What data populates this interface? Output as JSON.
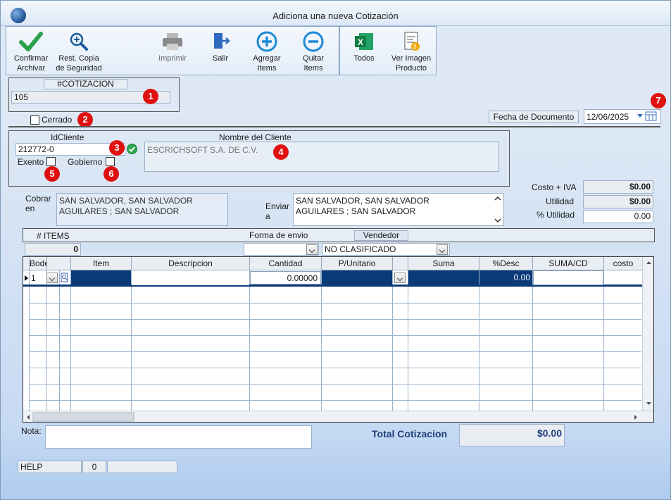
{
  "window": {
    "title": "Adiciona una nueva Cotización"
  },
  "toolbar": {
    "confirm_line1": "Confirmar",
    "confirm_line2": "Archivar",
    "restore_line1": "Rest. Copia",
    "restore_line2": "de Seguridad",
    "print_label": "Imprimir",
    "exit_label": "Salir",
    "add_line1": "Agregar",
    "add_line2": "Items",
    "remove_line1": "Quitar",
    "remove_line2": "Items",
    "excel_label": "Todos",
    "image_line1": "Ver Imagen",
    "image_line2": "Producto"
  },
  "quote": {
    "number_label": "#COTIZACION",
    "number_value": "105",
    "closed_label": "Cerrado"
  },
  "document_date": {
    "label": "Fecha de  Documento",
    "value": "12/06/2025"
  },
  "client": {
    "id_label": "IdCliente",
    "id_value": "212772-0",
    "name_label": "Nombre del Cliente",
    "name_value": "ESCRICHSOFT S.A. DE C.V.",
    "exempt_label": "Exento",
    "government_label": "Gobierno"
  },
  "addresses": {
    "bill_label_1": "Cobrar",
    "bill_label_2": "en",
    "bill_line1": "SAN SALVADOR, SAN SALVADOR",
    "bill_line2": "AGUILARES ; SAN SALVADOR",
    "ship_label_1": "Enviar",
    "ship_label_2": "a",
    "ship_line1": "SAN SALVADOR, SAN SALVADOR",
    "ship_line2": "AGUILARES ; SAN SALVADOR"
  },
  "totals_side": {
    "cost_label": "Costo + IVA",
    "cost_value": "$0.00",
    "profit_label": "Utilidad",
    "profit_value": "$0.00",
    "pct_label": "% Utilidad",
    "pct_value": "0.00"
  },
  "items_bar": {
    "count_label": "# ITEMS",
    "count_value": "0",
    "shipping_label": "Forma de envio",
    "shipping_value": "",
    "seller_label": "Vendedor",
    "seller_value": "NO CLASIFICADO"
  },
  "grid": {
    "columns": [
      "Bodega",
      "",
      "Item",
      "Descripcion",
      "Cantidad",
      "P/Unitario",
      "",
      "Suma",
      "%Desc",
      "SUMA/CD",
      "costo"
    ],
    "row": {
      "bodega": "1",
      "cantidad": "0.00000",
      "desc_pct": "0.00"
    }
  },
  "footer": {
    "note_label": "Nota:",
    "total_label": "Total Cotizacion",
    "total_value": "$0.00",
    "help_label": "HELP",
    "help_count": "0"
  },
  "badges": [
    "1",
    "2",
    "3",
    "4",
    "5",
    "6",
    "7"
  ],
  "colors": {
    "badge": "#e01010",
    "selected_row": "#0a3a78",
    "accent": "#2e6bc0"
  }
}
